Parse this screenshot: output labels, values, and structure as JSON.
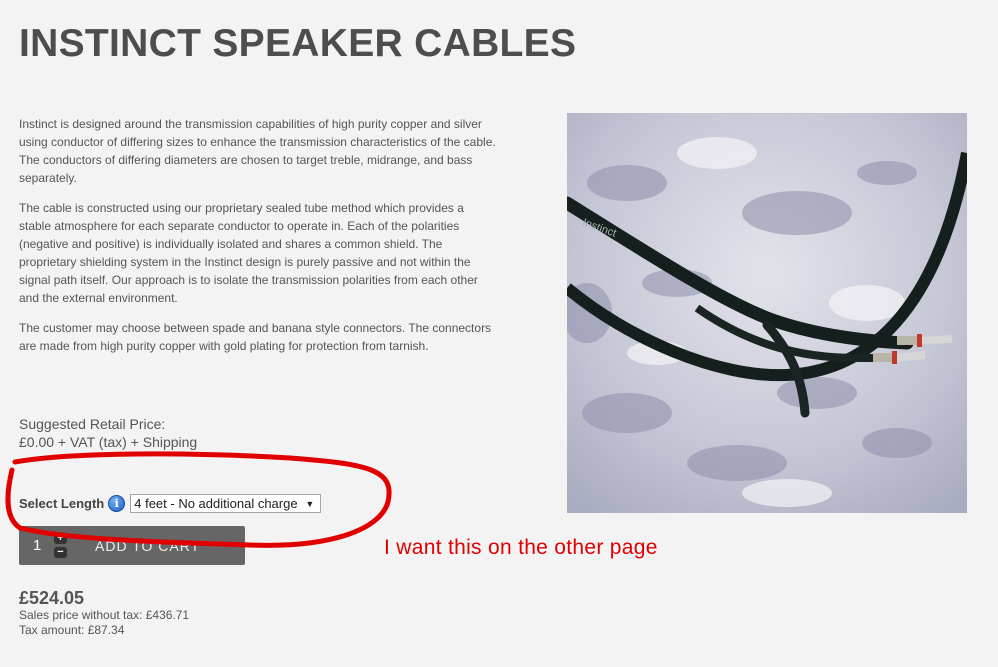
{
  "page": {
    "title": "INSTINCT SPEAKER CABLES"
  },
  "description": [
    "Instinct is designed around the transmission capabilities of high purity copper and silver using conductor of differing sizes to enhance the transmission characteristics of the cable. The conductors of differing diameters are chosen to target treble, midrange, and bass separately.",
    "The cable is constructed using our proprietary sealed tube method which provides a stable atmosphere for each separate conductor to operate in. Each of the polarities (negative and positive) is individually isolated and shares a common shield. The proprietary shielding system in the Instinct design is purely passive and not within the signal path itself. Our approach is to isolate the transmission polarities from each other and the external environment.",
    "The customer may choose between spade and banana style connectors. The connectors are made from high purity copper with gold plating for protection from tarnish."
  ],
  "pricing": {
    "suggested_label": "Suggested Retail Price:",
    "suggested_value": "£0.00 + VAT (tax) + Shipping",
    "final_price": "£524.05",
    "without_tax": "Sales price without tax: £436.71",
    "tax_amount": "Tax amount: £87.34"
  },
  "options": {
    "select_label": "Select Length",
    "info_icon": "i",
    "selected_value": "4 feet - No additional charge"
  },
  "cart": {
    "quantity": "1",
    "plus": "+",
    "minus": "−",
    "add_label": "ADD TO CART"
  },
  "annotation": {
    "text": "I want this on the other page",
    "color": "#e00000"
  },
  "image": {
    "printed_text": "Instinct",
    "icon": "speaker-cable-photo"
  }
}
